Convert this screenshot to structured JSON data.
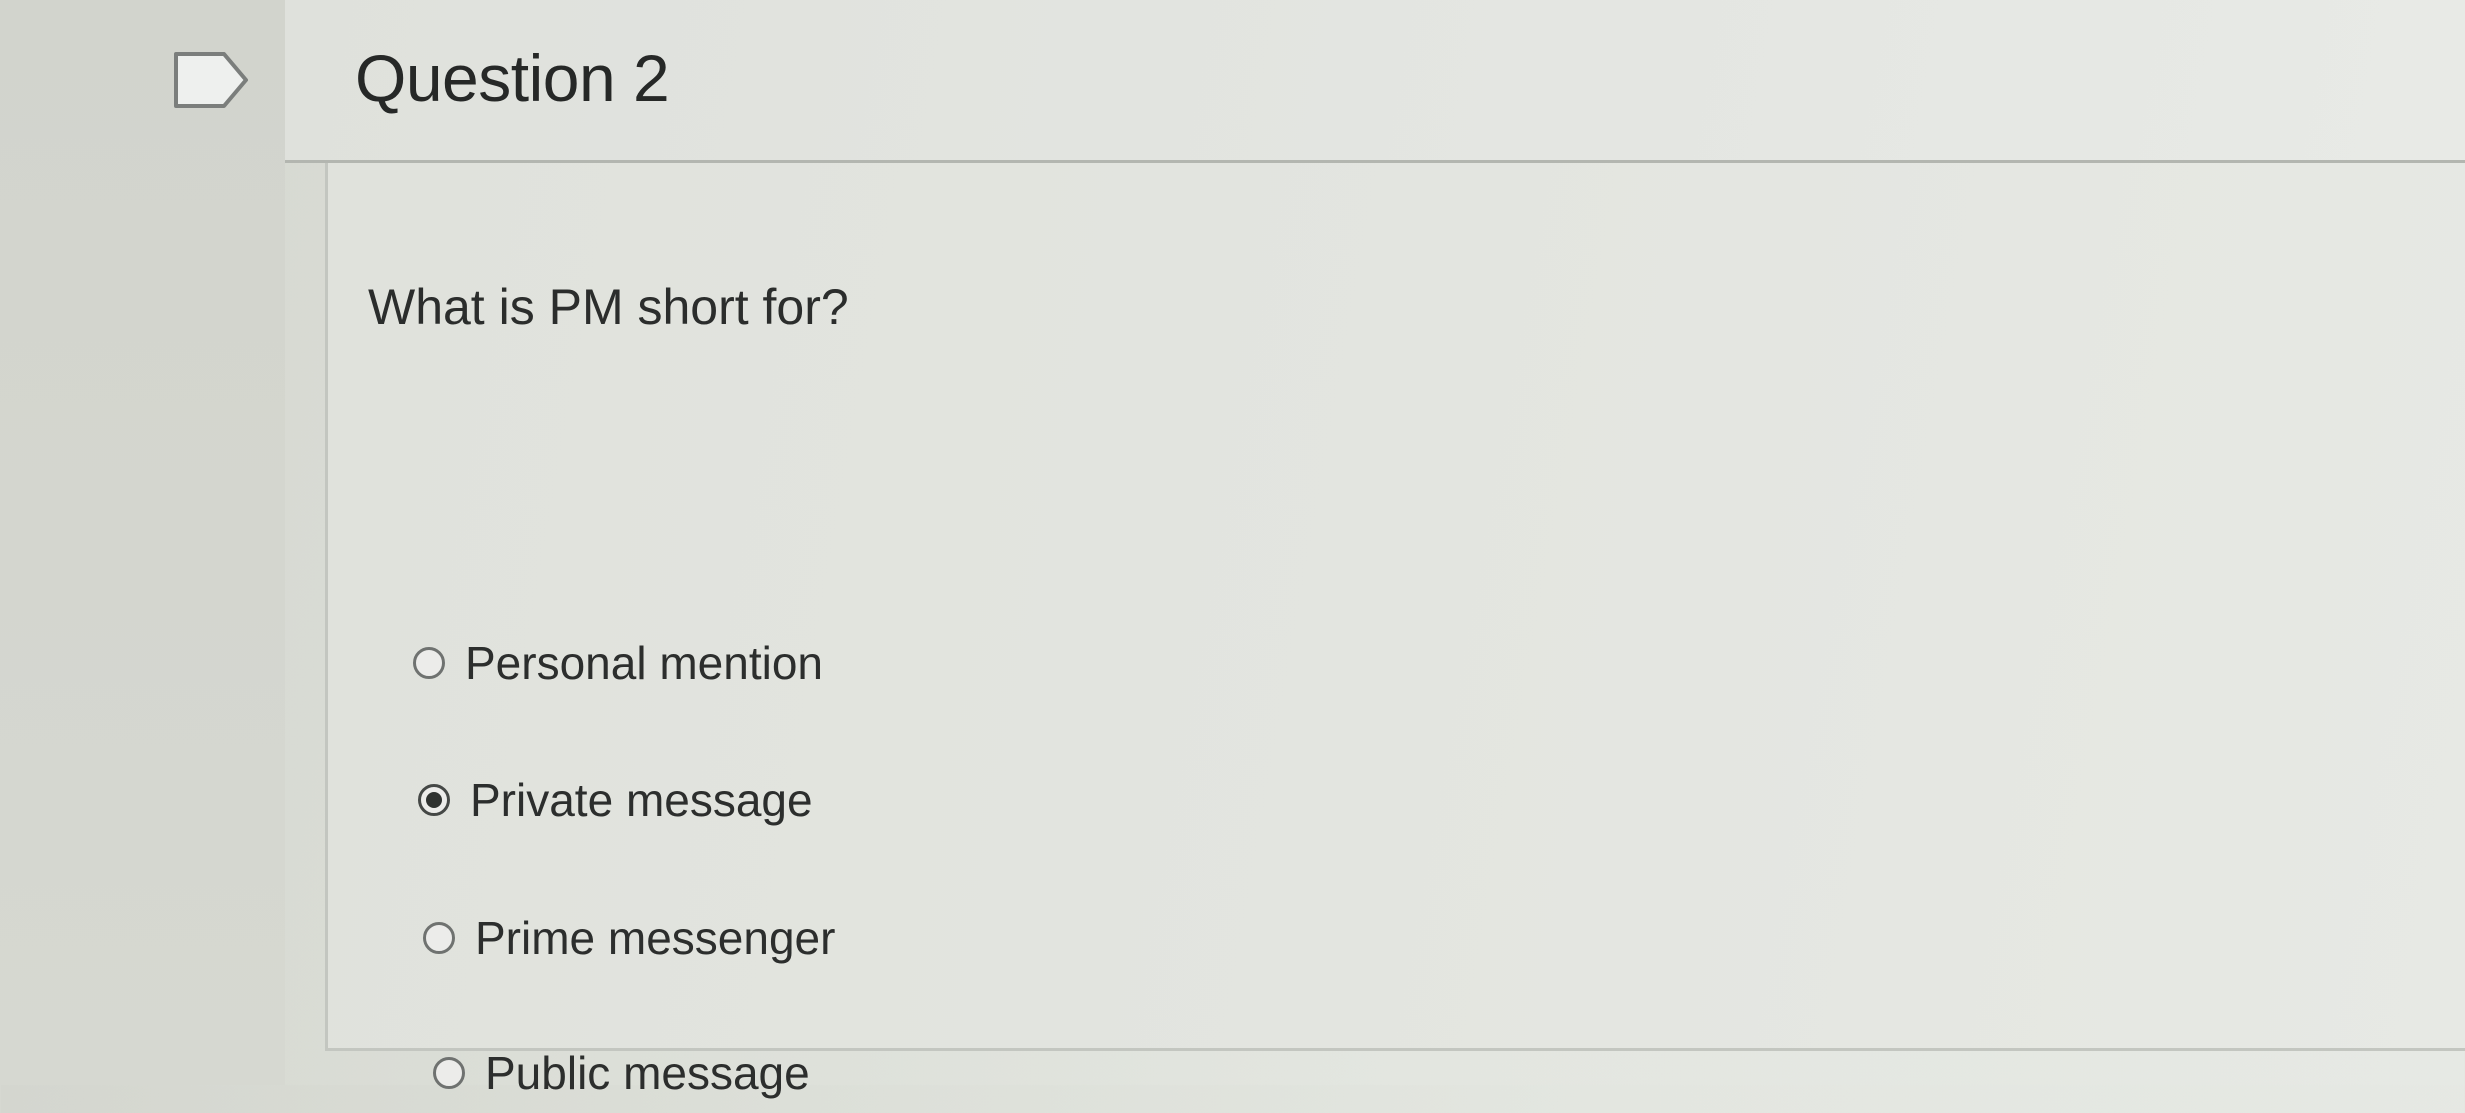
{
  "question": {
    "title": "Question 2",
    "flag_icon": "flag-icon",
    "text": "What is PM short for?",
    "answers": [
      {
        "label": "Personal mention",
        "selected": false
      },
      {
        "label": "Private message",
        "selected": true
      },
      {
        "label": "Prime messenger",
        "selected": false
      },
      {
        "label": "Public message",
        "selected": false
      }
    ]
  }
}
